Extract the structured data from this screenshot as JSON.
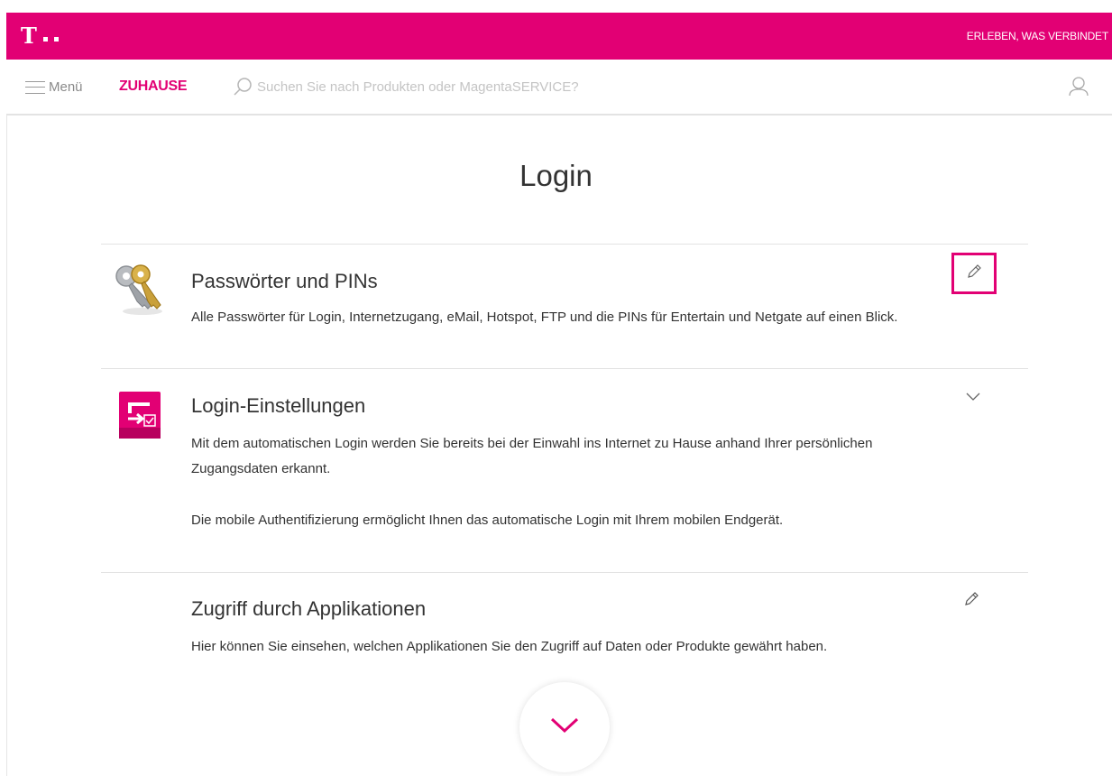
{
  "header": {
    "slogan": "ERLEBEN, WAS VERBINDET",
    "brand_color": "#e20074"
  },
  "nav": {
    "menu_label": "Menü",
    "home_label": "ZUHAUSE",
    "search_placeholder": "Suchen Sie nach Produkten oder MagentaSERVICE?",
    "search_value": ""
  },
  "page": {
    "title": "Login"
  },
  "items": [
    {
      "title": "Passwörter und PINs",
      "description": "Alle Passwörter für Login, Internetzugang, eMail, Hotspot, FTP und die PINs für Entertain und Netgate auf einen Blick.",
      "icon": "keys-icon",
      "action_icon": "pencil-icon"
    },
    {
      "title": "Login-Einstellungen",
      "description": "Mit dem automatischen Login werden Sie bereits bei der Einwahl ins Internet zu Hause anhand Ihrer persönlichen Zugangsdaten erkannt.",
      "description_2": "Die mobile Authentifizierung ermöglicht Ihnen das automatische Login mit Ihrem mobilen Endgerät.",
      "icon": "login-settings-icon",
      "action_icon": "chevron-down-icon"
    },
    {
      "title": "Zugriff durch Applikationen",
      "description": "Hier können Sie einsehen, welchen Applikationen Sie den Zugriff auf Daten oder Produkte gewährt haben.",
      "action_icon": "pencil-icon"
    }
  ]
}
